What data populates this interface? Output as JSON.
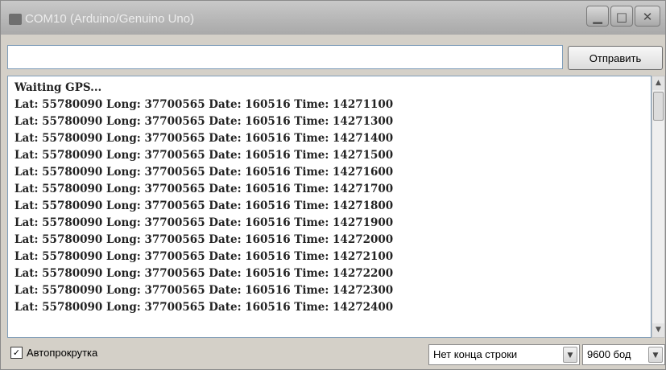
{
  "window": {
    "title": "COM10 (Arduino/Genuino Uno)",
    "controls": {
      "minimize": "▁",
      "maximize": "□",
      "close": "✕"
    }
  },
  "input": {
    "value": "",
    "send_label": "Отправить"
  },
  "output": {
    "lines": [
      "Waiting GPS...",
      "Lat: 55780090 Long: 37700565 Date: 160516 Time: 14271100",
      "Lat: 55780090 Long: 37700565 Date: 160516 Time: 14271300",
      "Lat: 55780090 Long: 37700565 Date: 160516 Time: 14271400",
      "Lat: 55780090 Long: 37700565 Date: 160516 Time: 14271500",
      "Lat: 55780090 Long: 37700565 Date: 160516 Time: 14271600",
      "Lat: 55780090 Long: 37700565 Date: 160516 Time: 14271700",
      "Lat: 55780090 Long: 37700565 Date: 160516 Time: 14271800",
      "Lat: 55780090 Long: 37700565 Date: 160516 Time: 14271900",
      "Lat: 55780090 Long: 37700565 Date: 160516 Time: 14272000",
      "Lat: 55780090 Long: 37700565 Date: 160516 Time: 14272100",
      "Lat: 55780090 Long: 37700565 Date: 160516 Time: 14272200",
      "Lat: 55780090 Long: 37700565 Date: 160516 Time: 14272300",
      "Lat: 55780090 Long: 37700565 Date: 160516 Time: 14272400"
    ]
  },
  "scrollbar": {
    "up": "▲",
    "down": "▼"
  },
  "footer": {
    "autoscroll_label": "Автопрокрутка",
    "autoscroll_checked": true,
    "checkmark": "✓",
    "line_ending": "Нет конца строки",
    "baud_rate": "9600 бод",
    "dropdown_arrow": "▼"
  },
  "icons": {
    "app": "serial-monitor-icon"
  }
}
